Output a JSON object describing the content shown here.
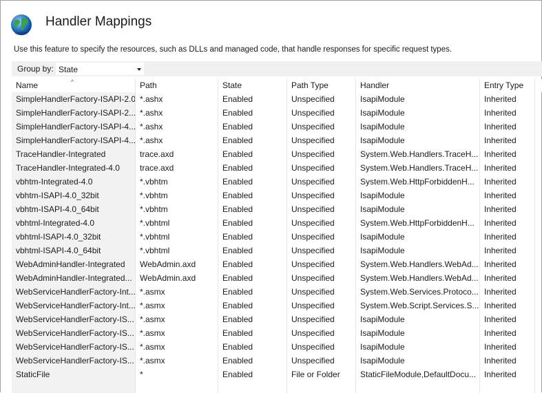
{
  "header": {
    "title": "Handler Mappings",
    "description": "Use this feature to specify the resources, such as DLLs and managed code, that handle responses for specific request types."
  },
  "toolbar": {
    "group_by_label": "Group by:",
    "group_by_value": "State"
  },
  "columns": [
    "Name",
    "Path",
    "State",
    "Path Type",
    "Handler",
    "Entry Type"
  ],
  "rows": [
    [
      "SimpleHandlerFactory-ISAPI-2.0",
      "*.ashx",
      "Enabled",
      "Unspecified",
      "IsapiModule",
      "Inherited"
    ],
    [
      "SimpleHandlerFactory-ISAPI-2...",
      "*.ashx",
      "Enabled",
      "Unspecified",
      "IsapiModule",
      "Inherited"
    ],
    [
      "SimpleHandlerFactory-ISAPI-4...",
      "*.ashx",
      "Enabled",
      "Unspecified",
      "IsapiModule",
      "Inherited"
    ],
    [
      "SimpleHandlerFactory-ISAPI-4...",
      "*.ashx",
      "Enabled",
      "Unspecified",
      "IsapiModule",
      "Inherited"
    ],
    [
      "TraceHandler-Integrated",
      "trace.axd",
      "Enabled",
      "Unspecified",
      "System.Web.Handlers.TraceH...",
      "Inherited"
    ],
    [
      "TraceHandler-Integrated-4.0",
      "trace.axd",
      "Enabled",
      "Unspecified",
      "System.Web.Handlers.TraceH...",
      "Inherited"
    ],
    [
      "vbhtm-Integrated-4.0",
      "*.vbhtm",
      "Enabled",
      "Unspecified",
      "System.Web.HttpForbiddenH...",
      "Inherited"
    ],
    [
      "vbhtm-ISAPI-4.0_32bit",
      "*.vbhtm",
      "Enabled",
      "Unspecified",
      "IsapiModule",
      "Inherited"
    ],
    [
      "vbhtm-ISAPI-4.0_64bit",
      "*.vbhtm",
      "Enabled",
      "Unspecified",
      "IsapiModule",
      "Inherited"
    ],
    [
      "vbhtml-Integrated-4.0",
      "*.vbhtml",
      "Enabled",
      "Unspecified",
      "System.Web.HttpForbiddenH...",
      "Inherited"
    ],
    [
      "vbhtml-ISAPI-4.0_32bit",
      "*.vbhtml",
      "Enabled",
      "Unspecified",
      "IsapiModule",
      "Inherited"
    ],
    [
      "vbhtml-ISAPI-4.0_64bit",
      "*.vbhtml",
      "Enabled",
      "Unspecified",
      "IsapiModule",
      "Inherited"
    ],
    [
      "WebAdminHandler-Integrated",
      "WebAdmin.axd",
      "Enabled",
      "Unspecified",
      "System.Web.Handlers.WebAd...",
      "Inherited"
    ],
    [
      "WebAdminHandler-Integrated...",
      "WebAdmin.axd",
      "Enabled",
      "Unspecified",
      "System.Web.Handlers.WebAd...",
      "Inherited"
    ],
    [
      "WebServiceHandlerFactory-Int...",
      "*.asmx",
      "Enabled",
      "Unspecified",
      "System.Web.Services.Protoco...",
      "Inherited"
    ],
    [
      "WebServiceHandlerFactory-Int...",
      "*.asmx",
      "Enabled",
      "Unspecified",
      "System.Web.Script.Services.S...",
      "Inherited"
    ],
    [
      "WebServiceHandlerFactory-IS...",
      "*.asmx",
      "Enabled",
      "Unspecified",
      "IsapiModule",
      "Inherited"
    ],
    [
      "WebServiceHandlerFactory-IS...",
      "*.asmx",
      "Enabled",
      "Unspecified",
      "IsapiModule",
      "Inherited"
    ],
    [
      "WebServiceHandlerFactory-IS...",
      "*.asmx",
      "Enabled",
      "Unspecified",
      "IsapiModule",
      "Inherited"
    ],
    [
      "WebServiceHandlerFactory-IS...",
      "*.asmx",
      "Enabled",
      "Unspecified",
      "IsapiModule",
      "Inherited"
    ],
    [
      "StaticFile",
      "*",
      "Enabled",
      "File or Folder",
      "StaticFileModule,DefaultDocu...",
      "Inherited"
    ]
  ],
  "icons": {
    "feature_icon": "globe-icon",
    "dropdown_icon": "chevron-down-icon",
    "sort_icon": "sort-ascending-icon"
  },
  "colors": {
    "toolbar_bg": "#f0f0f0",
    "name_column_bg": "#f2f2f2",
    "grid_line": "#e5e5e5"
  }
}
